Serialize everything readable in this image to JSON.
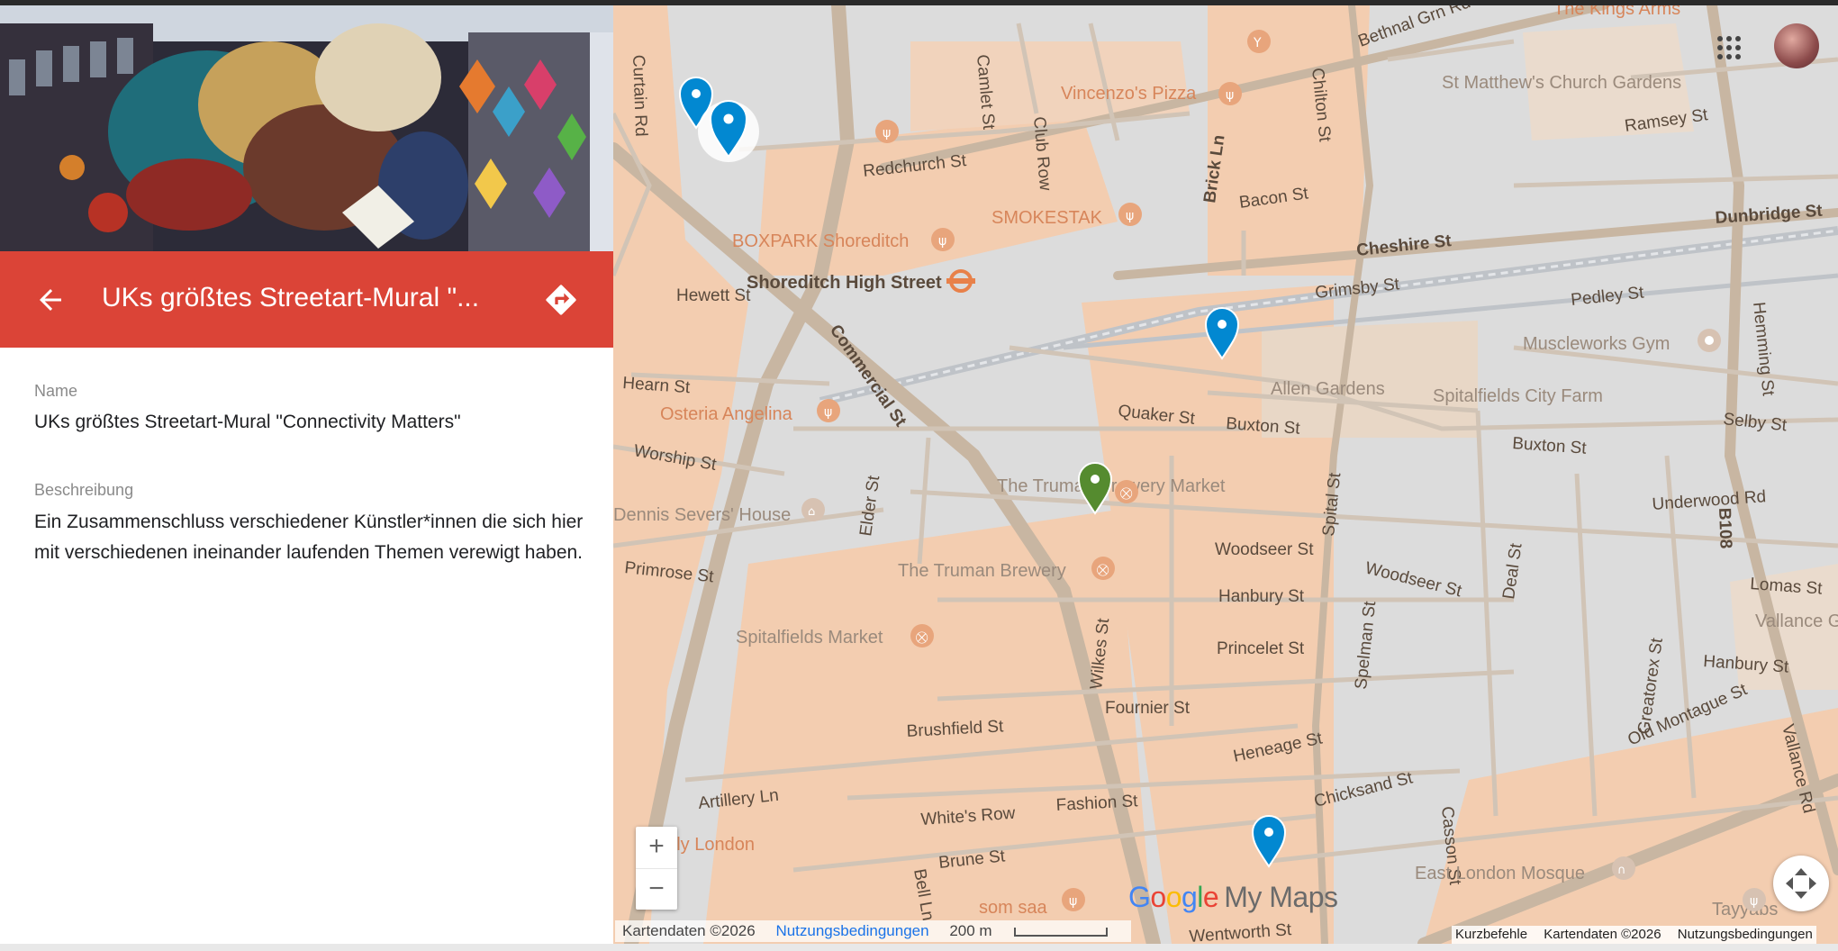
{
  "place": {
    "header_title": "UKs größtes Streetart-Mural \"...",
    "name_label": "Name",
    "name_value": "UKs größtes Streetart-Mural \"Connectivity Matters\"",
    "description_label": "Beschreibung",
    "description_value": "Ein Zusammenschluss verschiedener Künstler*innen die sich hier mit verschiedenen ineinander laufenden Themen verewigt haben."
  },
  "colors": {
    "header_red": "#db4437",
    "marker_blue": "#0288d1",
    "marker_green": "#558b2f",
    "road": "#c9b8a4",
    "area_peach": "#f3cdb0"
  },
  "icons": {
    "back": "arrow-left-icon",
    "directions": "directions-icon",
    "apps": "apps-grid-icon",
    "fullscreen": "fullscreen-icon"
  },
  "map": {
    "streets": [
      "Redchurch St",
      "Club Row",
      "Camlet St",
      "Curtain Rd",
      "Hewett St",
      "Hearn St",
      "Worship St",
      "Primrose St",
      "Elder St",
      "Commercial St",
      "Brick Ln",
      "Bacon St",
      "Cheshire St",
      "Grimsby St",
      "Pedley St",
      "Quaker St",
      "Buxton St",
      "Woodseer St",
      "Hanbury St",
      "Princelet St",
      "Fournier St",
      "Wilkes St",
      "Brushfield St",
      "Artillery Ln",
      "White's Row",
      "Brune St",
      "Bell Ln",
      "Fashion St",
      "Heneage St",
      "Chicksand St",
      "Spital St",
      "Spelman St",
      "Deal St",
      "Casson St",
      "Greatorex St",
      "Underwood Rd",
      "Old Montague St",
      "Vallance Rd",
      "B108",
      "Dunbridge St",
      "Ramsey St",
      "Chilton St",
      "Bethnal Grn Rd",
      "Selby St",
      "Hemming St",
      "Wentworth St",
      "Hanbury St",
      "Buxton St",
      "Woodseer St",
      "Lomas St",
      "Shoreditch High St",
      "Chicksand St",
      "Brick Ln",
      "Commercial St"
    ],
    "pois": [
      "Vincenzo's Pizza",
      "SMOKESTAK",
      "BOXPARK Shoreditch",
      "Shoreditch High Street",
      "Osteria Angelina",
      "Dennis Severs' House",
      "The Truman Brewery Market",
      "The Truman Brewery",
      "Spitalfields Market",
      "Allen Gardens",
      "Spitalfields City Farm",
      "Muscleworks Gym",
      "St Matthew's Church Gardens",
      "East London Mosque",
      "Tayyabs",
      "som saa",
      "Vallance Gardens",
      "Italy London",
      "The Kings Arms"
    ],
    "zoom_in": "+",
    "zoom_out": "−",
    "brand_google": "Google",
    "brand_mymaps": "My Maps",
    "footer_left": {
      "mapdata": "Kartendaten ©2026",
      "terms": "Nutzungsbedingungen",
      "scale": "200 m"
    },
    "footer_right": {
      "shortcuts": "Kurzbefehle",
      "mapdata": "Kartendaten ©2026",
      "terms": "Nutzungsbedingungen"
    }
  }
}
